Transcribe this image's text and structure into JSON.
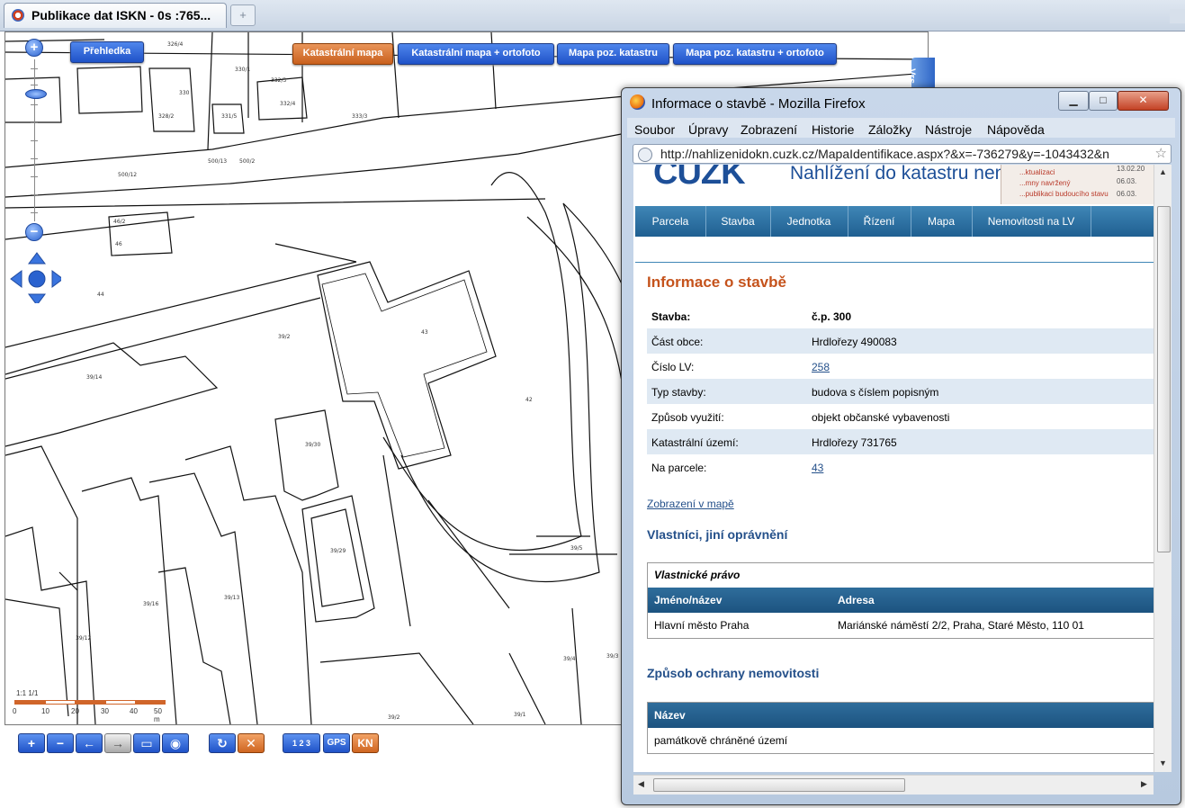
{
  "browser": {
    "tab_title": "Publikace dat ISKN - 0s :765...",
    "new_tab_symbol": "+"
  },
  "map": {
    "mode_buttons": [
      {
        "label": "Přehledka"
      },
      {
        "label": "Katastrální mapa"
      },
      {
        "label": "Katastrální mapa + ortofoto"
      },
      {
        "label": "Mapa poz. katastru"
      },
      {
        "label": "Mapa poz. katastru + ortofoto"
      }
    ],
    "zoom_in": "+",
    "zoom_out": "−",
    "side_tab": "Vrs",
    "scale": {
      "ratio": "1:1 1/1",
      "ticks": [
        "0",
        "10",
        "20",
        "30",
        "40",
        "50 m"
      ]
    },
    "bottom_toolbar": {
      "zoom_in": "+",
      "zoom_out": "−",
      "back": "←",
      "forward": "→",
      "extent": "▭",
      "info": "◉",
      "refresh": "↻",
      "clear": "✕",
      "numbers": "1 2 3",
      "gps": "GPS",
      "kn": "KN"
    },
    "parcel_labels": [
      "326/4",
      "330/1",
      "330",
      "332/3",
      "328/2",
      "331/5",
      "332/4",
      "333/3",
      "500/13",
      "500/12",
      "500/2",
      "46/2",
      "46",
      "44",
      "39/2",
      "43",
      "42",
      "39/14",
      "39/30",
      "39/29",
      "39/16",
      "39/13",
      "39/12",
      "39/5",
      "39/4",
      "39/2",
      "39/1",
      "39/3"
    ],
    "colors": {
      "active_button": "#c9601d",
      "button": "#1f52c8"
    }
  },
  "popup": {
    "title": "Informace o stavbě - Mozilla Firefox",
    "window_buttons": {
      "minimize": "▁",
      "maximize": "□",
      "close": "✕"
    },
    "menu": [
      "Soubor",
      "Úpravy",
      "Zobrazení",
      "Historie",
      "Záložky",
      "Nástroje",
      "Nápověda"
    ],
    "url": "http://nahlizenidokn.cuzk.cz/MapaIdentifikace.aspx?&x=-736279&y=-1043432&n",
    "page": {
      "logo": "ČÚZK",
      "site_title": "Nahlížení do katastru nemovitostí",
      "news": [
        {
          "text": "...ktualizaci",
          "date": "13.02.20"
        },
        {
          "text": "...mny navržený",
          "date": "06.03."
        },
        {
          "text": "...publikaci budoucího stavu",
          "date": "06.03."
        }
      ],
      "nav": [
        "Parcela",
        "Stavba",
        "Jednotka",
        "Řízení",
        "Mapa",
        "Nemovitosti na LV"
      ],
      "heading": "Informace o stavbě",
      "details": [
        {
          "label": "Stavba:",
          "value": "č.p. 300",
          "bold": true
        },
        {
          "label": "Část obce:",
          "value": "Hrdlořezy 490083"
        },
        {
          "label": "Číslo LV:",
          "value": "258",
          "link": true
        },
        {
          "label": "Typ stavby:",
          "value": "budova s číslem popisným"
        },
        {
          "label": "Způsob využití:",
          "value": "objekt občanské vybavenosti"
        },
        {
          "label": "Katastrální území:",
          "value": "Hrdlořezy 731765"
        },
        {
          "label": "Na parcele:",
          "value": "43",
          "link": true
        }
      ],
      "map_link": "Zobrazení v mapě",
      "owners_heading": "Vlastníci, jiní oprávnění",
      "owners_caption": "Vlastnické právo",
      "owners_columns": [
        "Jméno/název",
        "Adresa"
      ],
      "owners_rows": [
        {
          "name": "Hlavní město Praha",
          "address": "Mariánské náměstí 2/2, Praha, Staré Město, 110 01"
        }
      ],
      "protection_heading": "Způsob ochrany nemovitosti",
      "protection_column": "Název",
      "protection_rows": [
        "památkově chráněné území"
      ]
    }
  }
}
